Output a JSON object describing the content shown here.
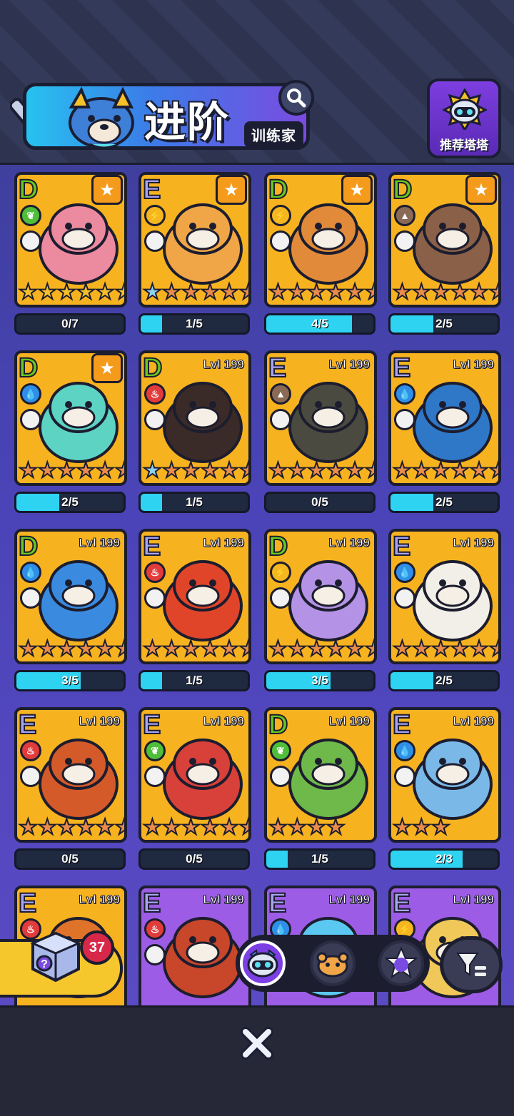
{
  "header": {
    "title": "进阶",
    "subtitle": "训练家",
    "recommend_label": "推荐塔塔"
  },
  "cards": [
    {
      "grade": "D",
      "element": "grass",
      "level": "",
      "star_badge": true,
      "progress": "0/7",
      "fill": 0.0,
      "stars": [
        "gold",
        "gold",
        "gold",
        "gold",
        "gold",
        "gold"
      ],
      "color": "#ec8aa0"
    },
    {
      "grade": "E",
      "element": "electric",
      "level": "",
      "star_badge": true,
      "progress": "1/5",
      "fill": 0.2,
      "stars": [
        "blue",
        "orange",
        "orange",
        "orange",
        "orange",
        "orange"
      ],
      "color": "#f0a646"
    },
    {
      "grade": "D",
      "element": "electric",
      "level": "",
      "star_badge": true,
      "progress": "4/5",
      "fill": 0.8,
      "stars": [
        "orange",
        "orange",
        "orange",
        "orange",
        "orange",
        "orange"
      ],
      "color": "#e08a3a"
    },
    {
      "grade": "D",
      "element": "earth",
      "level": "",
      "star_badge": true,
      "progress": "2/5",
      "fill": 0.4,
      "stars": [
        "orange",
        "orange",
        "orange",
        "orange",
        "orange",
        "orange"
      ],
      "color": "#8a6048"
    },
    {
      "grade": "D",
      "element": "water",
      "level": "",
      "star_badge": true,
      "progress": "2/5",
      "fill": 0.4,
      "stars": [
        "orange",
        "orange",
        "orange",
        "orange",
        "orange",
        "orange"
      ],
      "color": "#5dd3c4"
    },
    {
      "grade": "D",
      "element": "fire",
      "level": "Lvl 199",
      "star_badge": false,
      "progress": "1/5",
      "fill": 0.2,
      "stars": [
        "blue",
        "orange",
        "orange",
        "orange",
        "orange",
        "orange"
      ],
      "color": "#3a2a28"
    },
    {
      "grade": "E",
      "element": "earth",
      "level": "Lvl 199",
      "star_badge": false,
      "progress": "0/5",
      "fill": 0.0,
      "stars": [
        "orange",
        "orange",
        "orange",
        "orange",
        "orange",
        "orange"
      ],
      "color": "#4a4a40"
    },
    {
      "grade": "E",
      "element": "water",
      "level": "Lvl 199",
      "star_badge": false,
      "progress": "2/5",
      "fill": 0.4,
      "stars": [
        "orange",
        "orange",
        "orange",
        "orange",
        "orange",
        "orange"
      ],
      "color": "#2f78c8"
    },
    {
      "grade": "D",
      "element": "water",
      "level": "Lvl 199",
      "star_badge": false,
      "progress": "3/5",
      "fill": 0.6,
      "stars": [
        "orange",
        "orange",
        "orange",
        "orange",
        "orange",
        "orange"
      ],
      "color": "#3a8be0"
    },
    {
      "grade": "E",
      "element": "fire",
      "level": "Lvl 199",
      "star_badge": false,
      "progress": "1/5",
      "fill": 0.2,
      "stars": [
        "orange",
        "orange",
        "orange",
        "orange",
        "orange",
        "orange"
      ],
      "color": "#e0452a"
    },
    {
      "grade": "D",
      "element": "electric",
      "level": "Lvl 199",
      "star_badge": false,
      "progress": "3/5",
      "fill": 0.6,
      "stars": [
        "orange",
        "orange",
        "orange",
        "orange",
        "orange",
        "orange"
      ],
      "color": "#b493e6"
    },
    {
      "grade": "E",
      "element": "water",
      "level": "Lvl 199",
      "star_badge": false,
      "progress": "2/5",
      "fill": 0.4,
      "stars": [
        "orange",
        "orange",
        "orange",
        "orange",
        "orange",
        "orange"
      ],
      "color": "#f2efe8"
    },
    {
      "grade": "E",
      "element": "fire",
      "level": "Lvl 199",
      "star_badge": false,
      "progress": "0/5",
      "fill": 0.0,
      "stars": [
        "orange",
        "orange",
        "orange",
        "orange",
        "orange",
        "orange"
      ],
      "color": "#d45a2a"
    },
    {
      "grade": "E",
      "element": "grass",
      "level": "Lvl 199",
      "star_badge": false,
      "progress": "0/5",
      "fill": 0.0,
      "stars": [
        "orange",
        "orange",
        "orange",
        "orange",
        "orange",
        "orange"
      ],
      "color": "#d8403a"
    },
    {
      "grade": "D",
      "element": "grass",
      "level": "Lvl 199",
      "star_badge": false,
      "progress": "1/5",
      "fill": 0.2,
      "stars": [
        "orange",
        "orange",
        "orange",
        "orange"
      ],
      "color": "#6fb84a"
    },
    {
      "grade": "E",
      "element": "water",
      "level": "Lvl 199",
      "star_badge": false,
      "progress": "2/3",
      "fill": 0.67,
      "stars": [
        "orange",
        "orange",
        "orange"
      ],
      "color": "#7ab8e8"
    },
    {
      "grade": "E",
      "element": "fire",
      "level": "Lvl 199",
      "star_badge": false,
      "progress": "",
      "fill": 0,
      "stars": [],
      "color": "#e0732a"
    },
    {
      "grade": "E",
      "element": "fire",
      "level": "Lvl 199",
      "star_badge": false,
      "progress": "",
      "fill": 0,
      "stars": [],
      "color": "#c8462a",
      "purple": true
    },
    {
      "grade": "E",
      "element": "water",
      "level": "Lvl 199",
      "star_badge": false,
      "progress": "",
      "fill": 0,
      "stars": [],
      "color": "#5ac8f0",
      "purple": true
    },
    {
      "grade": "E",
      "element": "electric",
      "level": "Lvl 199",
      "star_badge": false,
      "progress": "",
      "fill": 0,
      "stars": [],
      "color": "#f0c85a",
      "purple": true
    }
  ],
  "chest": {
    "count": "37"
  },
  "filters": [
    {
      "name": "robot",
      "active": true
    },
    {
      "name": "hamster",
      "active": false
    },
    {
      "name": "purple-star",
      "active": false
    }
  ],
  "colors": {
    "grass": "#4fbf3a",
    "electric": "#f5b71f",
    "earth": "#8a6a55",
    "water": "#2f8fe8",
    "fire": "#e23b3b"
  }
}
